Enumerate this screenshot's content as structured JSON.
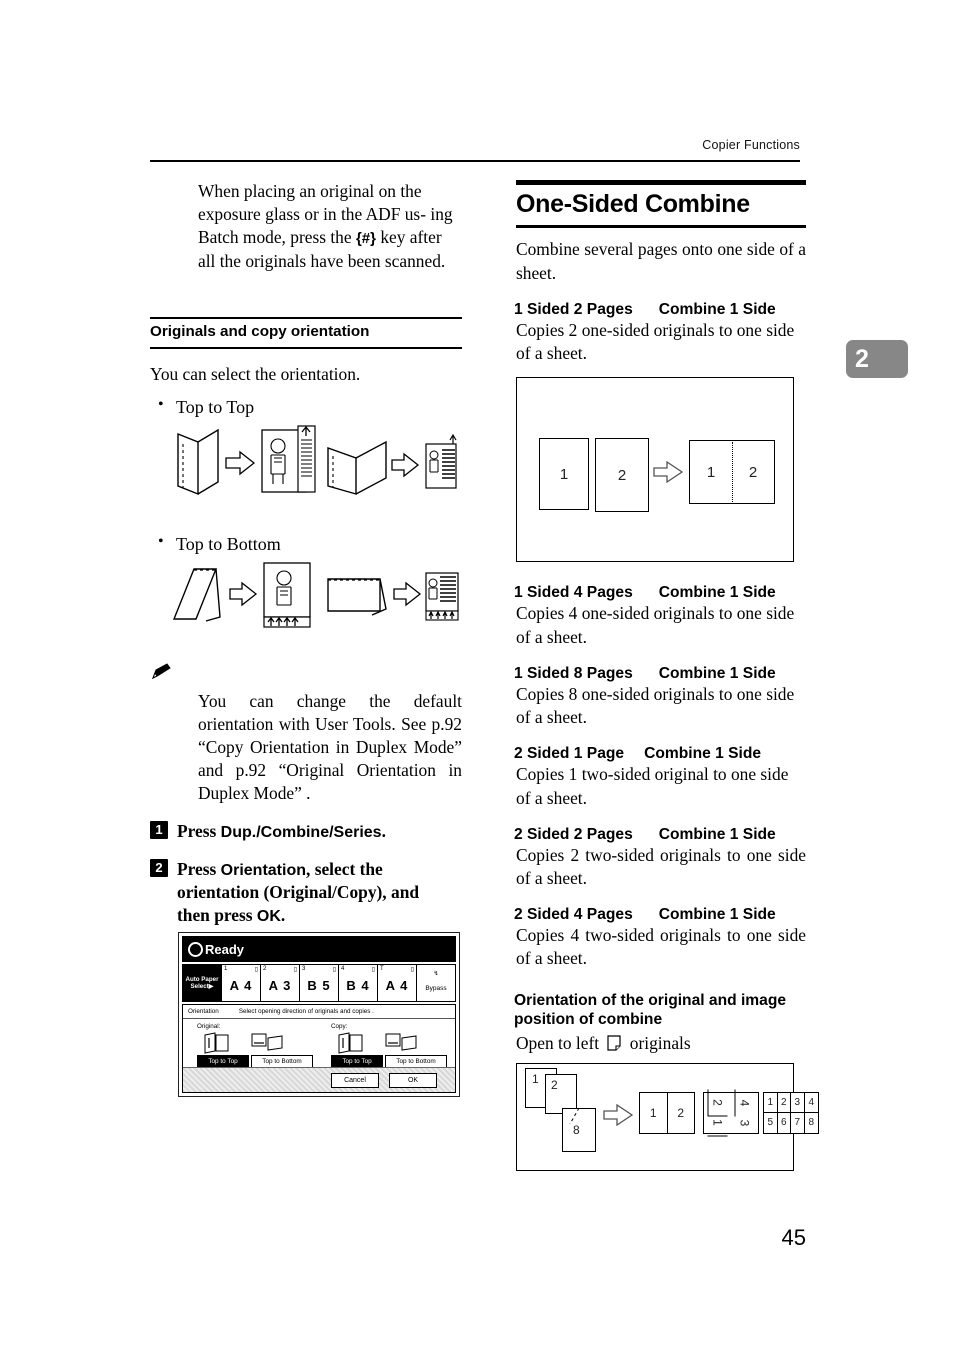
{
  "header": {
    "running_head": "Copier Functions",
    "page_number": "45",
    "chapter_tab": "2"
  },
  "left_column": {
    "intro_paragraph": "When placing an original on the exposure glass or in the ADF using Batch mode, press the {#} key after all the originals have been scanned.",
    "intro_part1": "When placing an original on the exposure glass or in the ADF us-",
    "intro_part2": "ing Batch mode, press the ",
    "intro_key": "{#}",
    "intro_part3": "key after all the originals have been scanned.",
    "section_heading": "Originals and copy orientation",
    "section_intro": "You can select the orientation.",
    "bullets": [
      {
        "label": "Top to Top"
      },
      {
        "label": "Top to Bottom"
      }
    ],
    "note_icon": "pencil-note-icon",
    "note_text": "You can change the default orientation with User Tools. See p.92 “Copy Orientation in Duplex Mode” and p.92 “Original Orientation in Duplex Mode” .",
    "steps": [
      {
        "number": "1",
        "pre": "Press",
        "key": "Dup./Combine/Series",
        "post": "."
      },
      {
        "number": "2",
        "pre": "Press",
        "key": "Orientation",
        "mid": ", select the orientation (Original/Copy), and then press",
        "key2": "OK",
        "post": "."
      }
    ]
  },
  "lcd": {
    "status": "Ready",
    "paper_buttons": [
      {
        "label_l1": "Auto Paper",
        "label_l2": "Select",
        "selected": true,
        "arrow": "▶"
      },
      {
        "index": "1",
        "size": "A 4",
        "selected": false
      },
      {
        "index": "2",
        "size": "A 3",
        "selected": false
      },
      {
        "index": "3",
        "size": "B 5",
        "selected": false
      },
      {
        "index": "4",
        "size": "B 4",
        "selected": false
      },
      {
        "index": "T",
        "size": "A 4",
        "selected": false
      },
      {
        "label_l1": "Bypass",
        "selected": false
      }
    ],
    "dialog_title": "Orientation",
    "dialog_hint": "Select opening direction of originals and copies .",
    "original_label": "Original:",
    "copy_label": "Copy:",
    "original_buttons": [
      {
        "label": "Top to Top",
        "selected": true
      },
      {
        "label": "Top to Bottom",
        "selected": false
      }
    ],
    "copy_buttons": [
      {
        "label": "Top to Top",
        "selected": true
      },
      {
        "label": "Top to Bottom",
        "selected": false
      }
    ],
    "cancel_label": "Cancel",
    "ok_label": "OK"
  },
  "right_column": {
    "title": "One-Sided Combine",
    "intro": "Combine several pages onto one side of a sheet.",
    "items": [
      {
        "heading_left": "1 Sided 2 Pages",
        "heading_right": "Combine 1 Side",
        "body": "Copies 2 one-sided originals to one side of a sheet.",
        "has_figure": true
      },
      {
        "heading_left": "1 Sided 4 Pages",
        "heading_right": "Combine 1 Side",
        "body": "Copies 4 one-sided originals to one side of a sheet.",
        "has_figure": false
      },
      {
        "heading_left": "1 Sided 8 Pages",
        "heading_right": "Combine 1 Side",
        "body": "Copies 8 one-sided originals to one side of a sheet.",
        "has_figure": false
      },
      {
        "heading_left": "2 Sided 1 Page",
        "heading_right": "Combine 1 Side",
        "body": "Copies 1 two-sided original to one side of a sheet.",
        "has_figure": false
      },
      {
        "heading_left": "2 Sided 2 Pages",
        "heading_right": "Combine 1 Side",
        "body": "Copies 2 two-sided originals to one side of a sheet.",
        "has_figure": false
      },
      {
        "heading_left": "2 Sided 4 Pages",
        "heading_right": "Combine 1 Side",
        "body": "Copies 4 two-sided originals to one side of a sheet.",
        "has_figure": false
      }
    ],
    "orientation_heading": "Orientation of the original and image position of combine",
    "orientation_caption_pre": "Open to left",
    "orientation_caption_post": "originals",
    "orientation_icon": "page-open-left-icon"
  },
  "figures": {
    "combine_2in1": {
      "originals": [
        "1",
        "2"
      ],
      "result_pages": [
        "1",
        "2"
      ],
      "arrow": "right-arrow-icon"
    },
    "orientation_example": {
      "originals": [
        "1",
        "2",
        "8"
      ],
      "arrow": "right-arrow-icon",
      "result_2up": [
        "1",
        "2"
      ],
      "result_4up": [
        "2",
        "4",
        "1",
        "3"
      ],
      "result_8up": [
        "1",
        "2",
        "3",
        "4",
        "5",
        "6",
        "7",
        "8"
      ]
    }
  }
}
